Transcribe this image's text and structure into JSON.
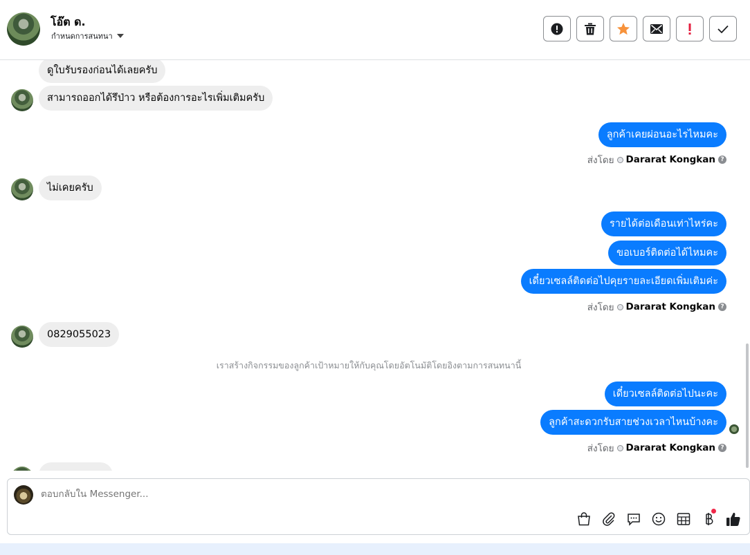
{
  "header": {
    "contact_name": "โอ๊ต ด.",
    "assign_label": "กำหนดการสนทนา"
  },
  "messages": {
    "in_1": "ดูใบรับรองก่อนได้เลยครับ",
    "in_2": "สามารถออกได้รึป่าว หรือต้องการอะไรเพิ่มเติมครับ",
    "out_1": "ลูกค้าเคยผ่อนอะไรไหมคะ",
    "in_3": "ไม่เคยครับ",
    "out_2": "รายได้ต่อเดือนเท่าไหร่คะ",
    "out_3": "ขอเบอร์ติดต่อได้ไหมคะ",
    "out_4": "เดี๋ยวเซลล์ติดต่อไปคุยรายละเอียดเพิ่มเติมค่ะ",
    "in_4": "0829055023",
    "system_note": "เราสร้างกิจกรรมของลูกค้าเป้าหมายให้กับคุณโดยอัตโนมัติโดยอิงตามการสนทนานี้",
    "out_5": "เดี๋ยวเซลล์ติดต่อไปนะคะ",
    "out_6": "ลูกค้าสะดวกรับสายช่วงเวลาไหนบ้างคะ"
  },
  "sent_by": {
    "prefix": "ส่งโดย",
    "agent": "Dararat Kongkan",
    "help": "?"
  },
  "composer": {
    "placeholder": "ตอบกลับใน Messenger..."
  },
  "colors": {
    "outgoing_bubble": "#0a7cff",
    "incoming_bubble": "#eeeeee",
    "star": "#f7923b",
    "alert": "#e41e3f"
  }
}
